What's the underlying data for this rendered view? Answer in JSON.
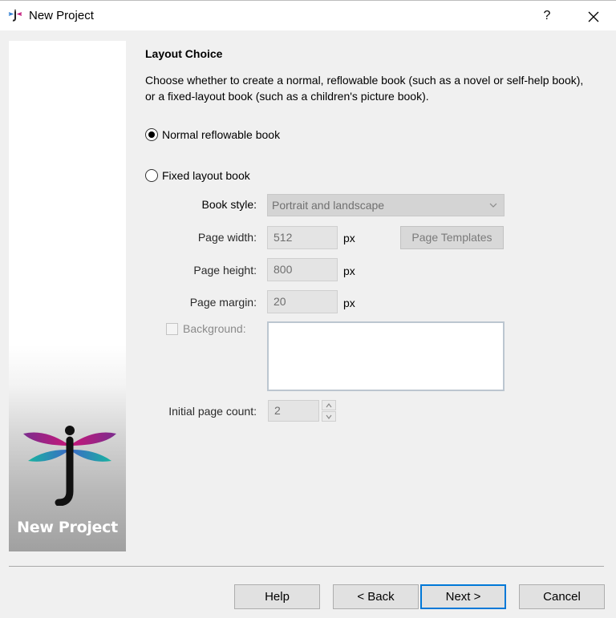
{
  "window": {
    "title": "New Project",
    "help_label": "?",
    "close_icon": "close-icon",
    "app_icon": "jutoh-app-icon"
  },
  "sidebar": {
    "caption": "New Project",
    "logo_icon": "dragonfly-j-logo"
  },
  "content": {
    "heading": "Layout Choice",
    "description": "Choose whether to create a normal, reflowable book (such as a novel or self-help book), or a fixed-layout book (such as a children's picture book).",
    "options": [
      {
        "label": "Normal reflowable book",
        "selected": true
      },
      {
        "label": "Fixed layout book",
        "selected": false
      }
    ]
  },
  "fixed_layout": {
    "book_style": {
      "label": "Book style:",
      "value": "Portrait and landscape"
    },
    "page_width": {
      "label": "Page width:",
      "value": "512",
      "unit": "px"
    },
    "page_height": {
      "label": "Page height:",
      "value": "800",
      "unit": "px"
    },
    "page_margin": {
      "label": "Page margin:",
      "value": "20",
      "unit": "px"
    },
    "page_templates_label": "Page Templates",
    "background": {
      "label": "Background:",
      "checked": false,
      "value": ""
    },
    "initial_page_count": {
      "label": "Initial page count:",
      "value": "2"
    }
  },
  "footer": {
    "help_label": "Help",
    "back_label": "< Back",
    "next_label": "Next >",
    "cancel_label": "Cancel"
  },
  "colors": {
    "default_button_border": "#0078d7",
    "dragonfly_purple": "#7b2d8e",
    "dragonfly_magenta": "#c2187a",
    "dragonfly_teal": "#1fa7a0",
    "dragonfly_blue": "#3a6fc4"
  }
}
